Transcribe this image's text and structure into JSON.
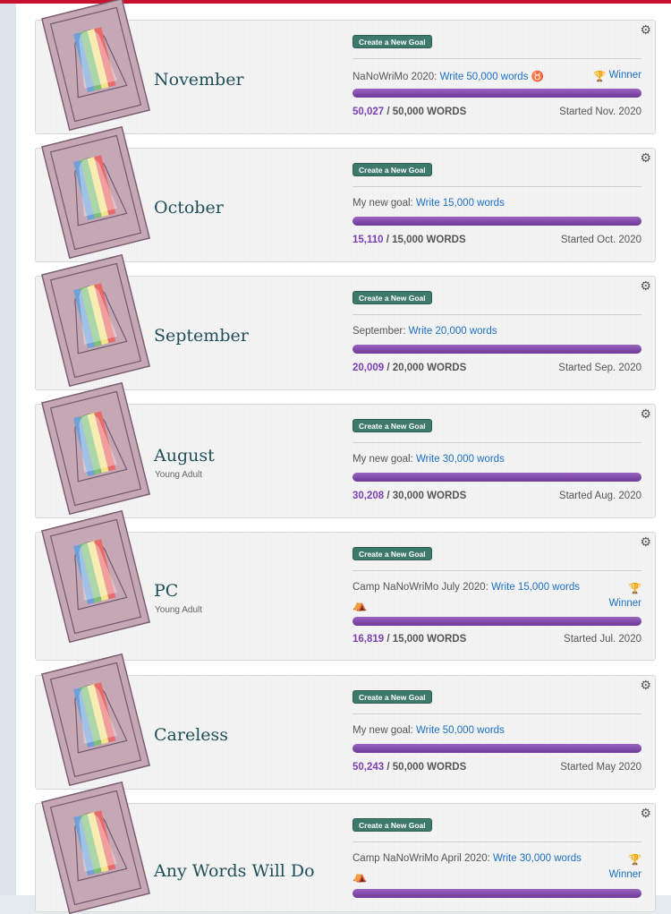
{
  "page": {
    "create_button_label": "Create a New Goal",
    "words_suffix": "WORDS",
    "winner_label": "Winner"
  },
  "colors": {
    "accent_bar": "#7d4aa8",
    "button": "#3d7a6b",
    "title": "#1f5059",
    "link": "#1a6fc4",
    "top_bar": "#c8102e"
  },
  "icons": {
    "settings": "gear-icon",
    "winner": "trophy-icon",
    "cover": "keyhole-cover-icon"
  },
  "projects": [
    {
      "title": "November",
      "genre": "",
      "goal_prefix": "NaNoWriMo 2020:",
      "goal_link": "Write 50,000 words",
      "current": "50,027",
      "target": "50,000",
      "started": "Started Nov. 2020",
      "progress": 1.0
    },
    {
      "title": "October",
      "genre": "",
      "goal_prefix": "My new goal:",
      "goal_link": "Write 15,000 words",
      "current": "15,110",
      "target": "15,000",
      "started": "Started Oct. 2020",
      "progress": 1.0
    },
    {
      "title": "September",
      "genre": "",
      "goal_prefix": "September:",
      "goal_link": "Write 20,000 words",
      "current": "20,009",
      "target": "20,000",
      "started": "Started Sep. 2020",
      "progress": 1.0
    },
    {
      "title": "August",
      "genre": "Young Adult",
      "goal_prefix": "My new goal:",
      "goal_link": "Write 30,000 words",
      "current": "30,208",
      "target": "30,000",
      "started": "Started Aug. 2020",
      "progress": 1.0
    },
    {
      "title": "PC",
      "genre": "Young Adult",
      "goal_prefix": "Camp NaNoWriMo July 2020:",
      "goal_link": "Write 15,000 words",
      "current": "16,819",
      "target": "15,000",
      "started": "Started Jul. 2020",
      "progress": 1.0
    },
    {
      "title": "Careless",
      "genre": "",
      "goal_prefix": "My new goal:",
      "goal_link": "Write 50,000 words",
      "current": "50,243",
      "target": "50,000",
      "started": "Started May 2020",
      "progress": 1.0
    },
    {
      "title": "Any Words Will Do",
      "genre": "",
      "goal_prefix": "Camp NaNoWriMo April 2020:",
      "goal_link": "Write 30,000 words",
      "current": "",
      "target": "",
      "started": "",
      "progress": 1.0
    }
  ]
}
